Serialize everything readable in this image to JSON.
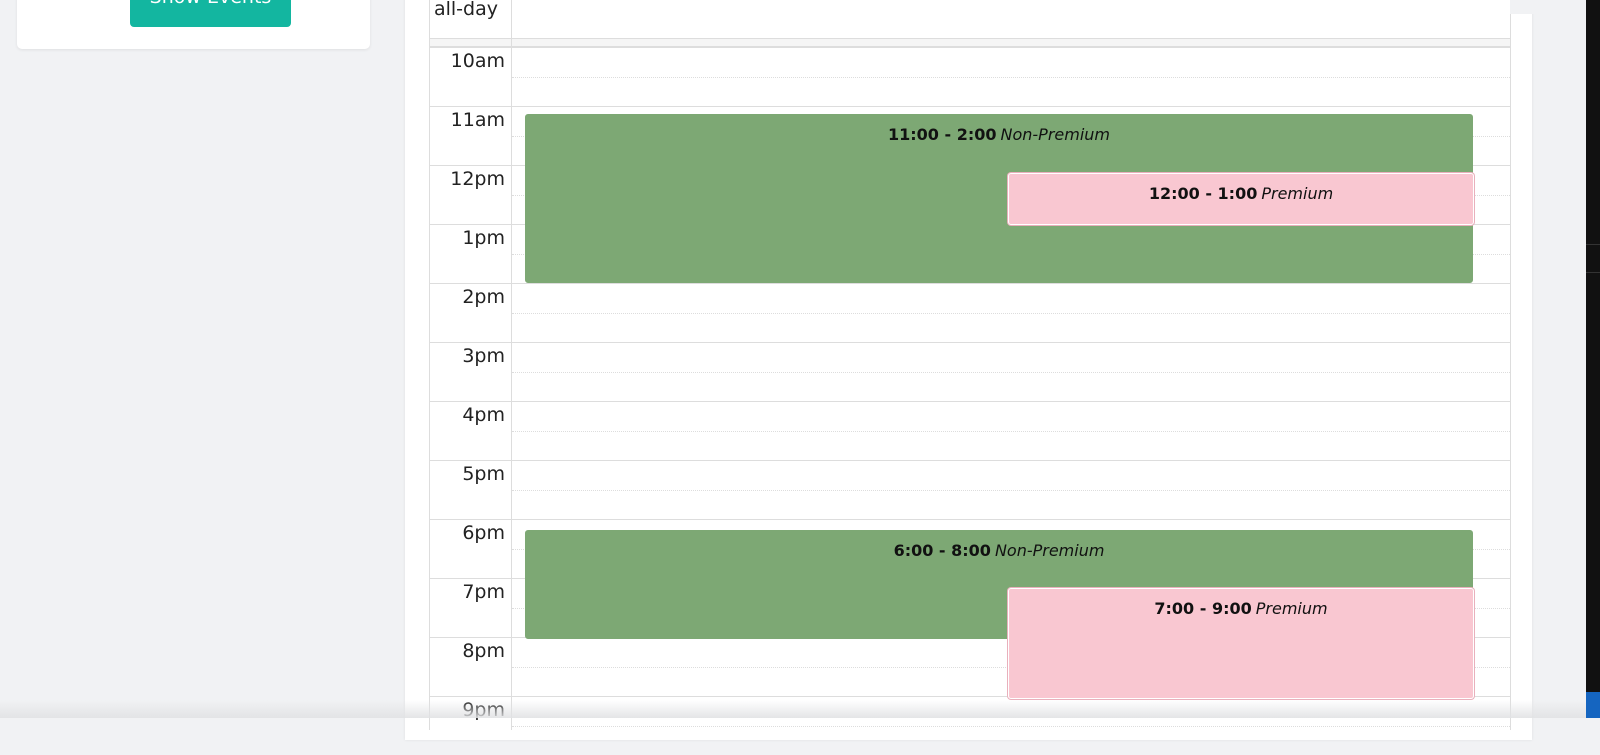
{
  "sidebar": {
    "show_events_label": "Show Events"
  },
  "calendar": {
    "allday_label": "all-day",
    "hours": [
      "10am",
      "11am",
      "12pm",
      "1pm",
      "2pm",
      "3pm",
      "4pm",
      "5pm",
      "6pm",
      "7pm",
      "8pm",
      "9pm"
    ],
    "events": [
      {
        "time": "11:00 - 2:00",
        "title": "Non-Premium",
        "color": "#7da874"
      },
      {
        "time": "12:00 - 1:00",
        "title": "Premium",
        "color": "#f9c7d1"
      },
      {
        "time": "6:00 - 8:00",
        "title": "Non-Premium",
        "color": "#7da874"
      },
      {
        "time": "7:00 - 9:00",
        "title": "Premium",
        "color": "#f9c7d1"
      }
    ]
  },
  "colors": {
    "accent": "#13b6a0",
    "non_premium": "#7da874",
    "premium": "#f9c7d1"
  }
}
